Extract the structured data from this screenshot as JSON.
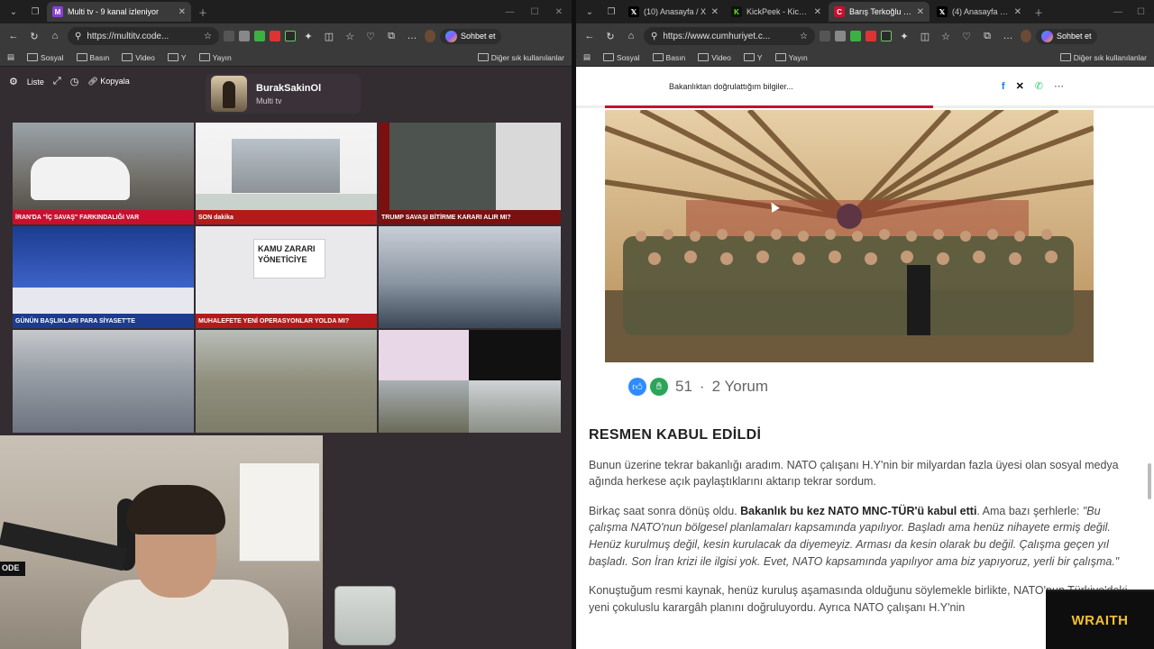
{
  "left": {
    "tabs": [
      {
        "title": "Multi tv - 9 kanal izleniyor",
        "active": true
      }
    ],
    "url": "https://multitv.code...",
    "copilot": "Sohbet et",
    "bookmarks": [
      "Sosyal",
      "Basın",
      "Video",
      "Y",
      "Yayın"
    ],
    "bookmarks_other": "Diğer sık kullanılanlar",
    "toolbar": {
      "list_label": "Liste",
      "copy_label": "Kopyala"
    },
    "profile": {
      "name": "BurakSakinOl",
      "subtitle": "Multi tv"
    },
    "channels": [
      {
        "lower": "İRAN'DA \"İÇ SAVAŞ\" FARKINDALIĞI VAR",
        "color": "#c8102e"
      },
      {
        "lower": "SON dakika",
        "color": "#b31b1b"
      },
      {
        "lower": "TRUMP SAVAŞI BİTİRME KARARI ALIR MI?",
        "color": "#7a1010"
      },
      {
        "lower": "GÜNÜN BAŞLIKLARI PARA SİYASET'TE",
        "color": "#1d3c8f"
      },
      {
        "lower": "MUHALEFETE YENİ OPERASYONLAR YOLDA MI?",
        "color": "#b31b1b",
        "headline": "KAMU ZARARI YÖNETİCİYE"
      },
      {
        "lower": "",
        "color": "#3b4756"
      },
      {
        "lower": "",
        "color": "#6d7480"
      },
      {
        "lower": "",
        "color": "#7d7d6a"
      },
      {
        "lower": "",
        "color": "#3a3a4a"
      }
    ],
    "cam_text": "ODE"
  },
  "right": {
    "tabs": [
      {
        "title": "(10) Anasayfa / X",
        "icon": "X",
        "color": "#000"
      },
      {
        "title": "KickPeek - Kick.com",
        "icon": "K",
        "color": "#53fc18"
      },
      {
        "title": "Barış Terkoğlu yazdı",
        "icon": "C",
        "color": "#c8102e",
        "active": true
      },
      {
        "title": "(4) Anasayfa / X",
        "icon": "X",
        "color": "#000"
      }
    ],
    "url": "https://www.cumhuriyet.c...",
    "copilot": "Sohbet et",
    "bookmarks": [
      "Sosyal",
      "Basın",
      "Video",
      "Y",
      "Yayın"
    ],
    "bookmarks_other": "Diğer sık kullanılanlar",
    "share_title": "Bakanlıktan doğrulattığım bilgiler...",
    "reactions": {
      "count": "51",
      "comments": "2 Yorum"
    },
    "article": {
      "heading": "RESMEN KABUL EDİLDİ",
      "p1": "Bunun üzerine tekrar bakanlığı aradım. NATO çalışanı H.Y'nin bir milyardan fazla üyesi olan sosyal medya ağında herkese açık paylaştıklarını aktarıp tekrar sordum.",
      "p2_intro": "Birkaç saat sonra dönüş oldu. ",
      "p2_bold": "Bakanlık bu kez NATO MNC-TÜR'ü kabul etti",
      "p2_rest": ". Ama bazı şerhlerle: ",
      "p2_quote": "\"Bu çalışma NATO'nun bölgesel planlamaları kapsamında yapılıyor. Başladı ama henüz nihayete ermiş değil. Henüz kurulmuş değil, kesin kurulacak da diyemeyiz. Arması da kesin olarak bu değil. Çalışma geçen yıl başladı. Son İran krizi ile ilgisi yok. Evet, NATO kapsamında yapılıyor ama biz yapıyoruz, yerli bir çalışma.\"",
      "p3": "Konuştuğum resmi kaynak, henüz kuruluş aşamasında olduğunu söylemekle birlikte, NATO'nun Türkiye'deki yeni çokuluslu karargâh planını doğruluyordu. Ayrıca NATO çalışanı H.Y'nin"
    }
  },
  "overlay": {
    "brand": "WRAITH"
  }
}
